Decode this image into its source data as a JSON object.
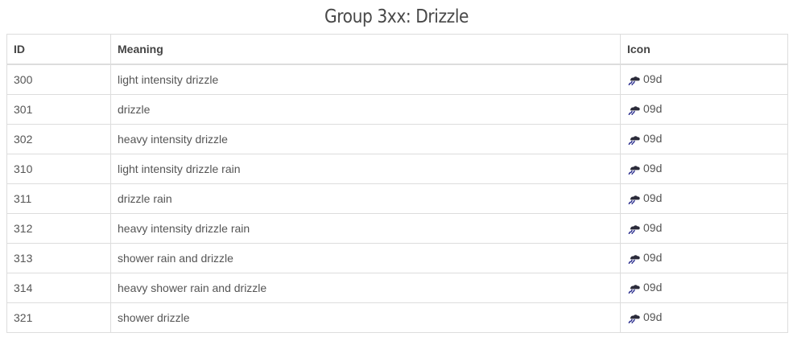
{
  "title": "Group 3xx: Drizzle",
  "table": {
    "headers": {
      "id": "ID",
      "meaning": "Meaning",
      "icon": "Icon"
    },
    "rows": [
      {
        "id": "300",
        "meaning": "light intensity drizzle",
        "icon": "09d",
        "icon_name": "drizzle-icon"
      },
      {
        "id": "301",
        "meaning": "drizzle",
        "icon": "09d",
        "icon_name": "drizzle-icon"
      },
      {
        "id": "302",
        "meaning": "heavy intensity drizzle",
        "icon": "09d",
        "icon_name": "drizzle-icon"
      },
      {
        "id": "310",
        "meaning": "light intensity drizzle rain",
        "icon": "09d",
        "icon_name": "drizzle-icon"
      },
      {
        "id": "311",
        "meaning": "drizzle rain",
        "icon": "09d",
        "icon_name": "drizzle-icon"
      },
      {
        "id": "312",
        "meaning": "heavy intensity drizzle rain",
        "icon": "09d",
        "icon_name": "drizzle-icon"
      },
      {
        "id": "313",
        "meaning": "shower rain and drizzle",
        "icon": "09d",
        "icon_name": "drizzle-icon"
      },
      {
        "id": "314",
        "meaning": "heavy shower rain and drizzle",
        "icon": "09d",
        "icon_name": "drizzle-icon"
      },
      {
        "id": "321",
        "meaning": "shower drizzle",
        "icon": "09d",
        "icon_name": "drizzle-icon"
      }
    ]
  },
  "colors": {
    "border": "#dddddd",
    "text": "#555555",
    "heading": "#484848",
    "icon_cloud": "#2b2b3a",
    "icon_rain": "#2c2f8f"
  }
}
